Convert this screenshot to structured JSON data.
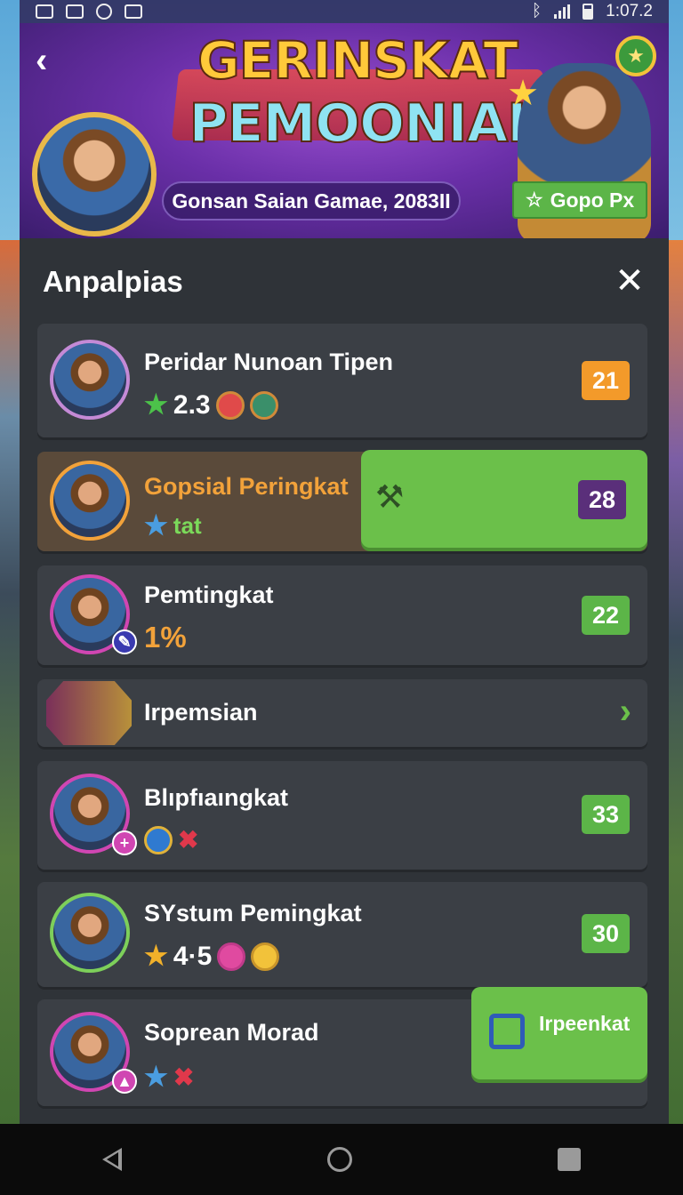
{
  "status_bar": {
    "time": "1:07.2"
  },
  "header": {
    "back_icon": "chevron-left-icon",
    "title_line1": "GERINSKAT",
    "title_line2": "PEMOONIAI",
    "subtitle": "Gonsan Saian Gamae, 2083II",
    "action_label": "Gopo Px",
    "action_icon": "star-outline-icon"
  },
  "panel": {
    "title": "Anpalpias",
    "close_icon": "close-icon"
  },
  "rows": [
    {
      "name": "Peridar Nunoan Tipen",
      "rating": "2.3",
      "score": "21",
      "score_color": "#f39a2a"
    },
    {
      "name": "Gopsial Peringkat",
      "sub": "tat",
      "score": "28",
      "score_color": "#5a2f7a"
    },
    {
      "name": "Pemtingkat",
      "sub": "1%",
      "score": "22",
      "score_color": "#5cb548"
    },
    {
      "name": "Irpemsian"
    },
    {
      "name": "Blıpfıaıngkat",
      "score": "33",
      "score_color": "#5cb548"
    },
    {
      "name": "SYstum Pemingkat",
      "rating": "4·5",
      "score": "30",
      "score_color": "#5cb548"
    },
    {
      "name": "Soprean Morad",
      "action_label": "Irpeenkat"
    }
  ],
  "colors": {
    "panel_bg": "#2f3338",
    "row_bg": "#3b3f45",
    "accent_green": "#6bc04a",
    "highlight_orange": "#f2a23a"
  }
}
